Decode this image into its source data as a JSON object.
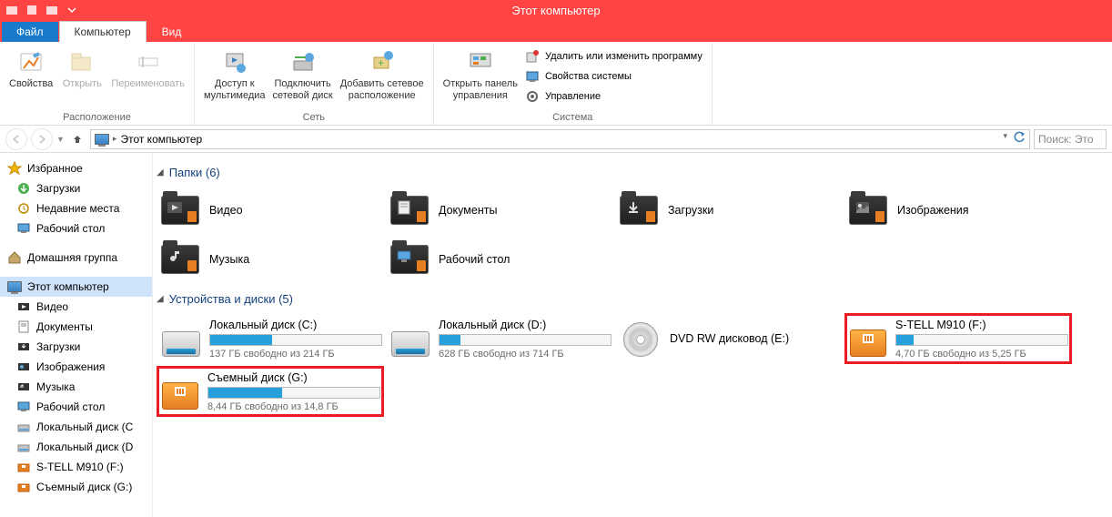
{
  "titlebar": {
    "title": "Этот компьютер"
  },
  "tabs": {
    "file": "Файл",
    "computer": "Компьютер",
    "view": "Вид"
  },
  "ribbon": {
    "groups": {
      "location": {
        "label": "Расположение",
        "properties": "Свойства",
        "open": "Открыть",
        "rename": "Переименовать"
      },
      "network": {
        "label": "Сеть",
        "media": "Доступ к\nмультимедиа",
        "map_drive": "Подключить\nсетевой диск",
        "add_location": "Добавить сетевое\nрасположение"
      },
      "system": {
        "label": "Система",
        "control_panel": "Открыть панель\nуправления",
        "uninstall": "Удалить или изменить программу",
        "sys_props": "Свойства системы",
        "manage": "Управление"
      }
    }
  },
  "address": {
    "crumb": "Этот компьютер"
  },
  "search": {
    "placeholder": "Поиск: Это"
  },
  "sidebar": {
    "favorites": {
      "label": "Избранное",
      "items": [
        "Загрузки",
        "Недавние места",
        "Рабочий стол"
      ]
    },
    "homegroup": "Домашняя группа",
    "computer": {
      "label": "Этот компьютер",
      "items": [
        "Видео",
        "Документы",
        "Загрузки",
        "Изображения",
        "Музыка",
        "Рабочий стол",
        "Локальный диск (C",
        "Локальный диск (D",
        "S-TELL M910 (F:)",
        "Съемный диск (G:)"
      ]
    }
  },
  "content": {
    "folders_header": "Папки (6)",
    "folders": [
      "Видео",
      "Документы",
      "Загрузки",
      "Изображения",
      "Музыка",
      "Рабочий стол"
    ],
    "drives_header": "Устройства и диски (5)",
    "drives": [
      {
        "name": "Локальный диск (C:)",
        "free": "137 ГБ свободно из 214 ГБ",
        "fill": 36,
        "type": "hdd",
        "hl": false
      },
      {
        "name": "Локальный диск (D:)",
        "free": "628 ГБ свободно из 714 ГБ",
        "fill": 12,
        "type": "hdd",
        "hl": false
      },
      {
        "name": "DVD RW дисковод (E:)",
        "free": "",
        "fill": 0,
        "type": "dvd",
        "hl": false
      },
      {
        "name": "S-TELL M910 (F:)",
        "free": "4,70 ГБ свободно из 5,25 ГБ",
        "fill": 10,
        "type": "usb",
        "hl": true
      },
      {
        "name": "Съемный диск (G:)",
        "free": "8,44 ГБ свободно из 14,8 ГБ",
        "fill": 43,
        "type": "usb",
        "hl": true
      }
    ]
  }
}
